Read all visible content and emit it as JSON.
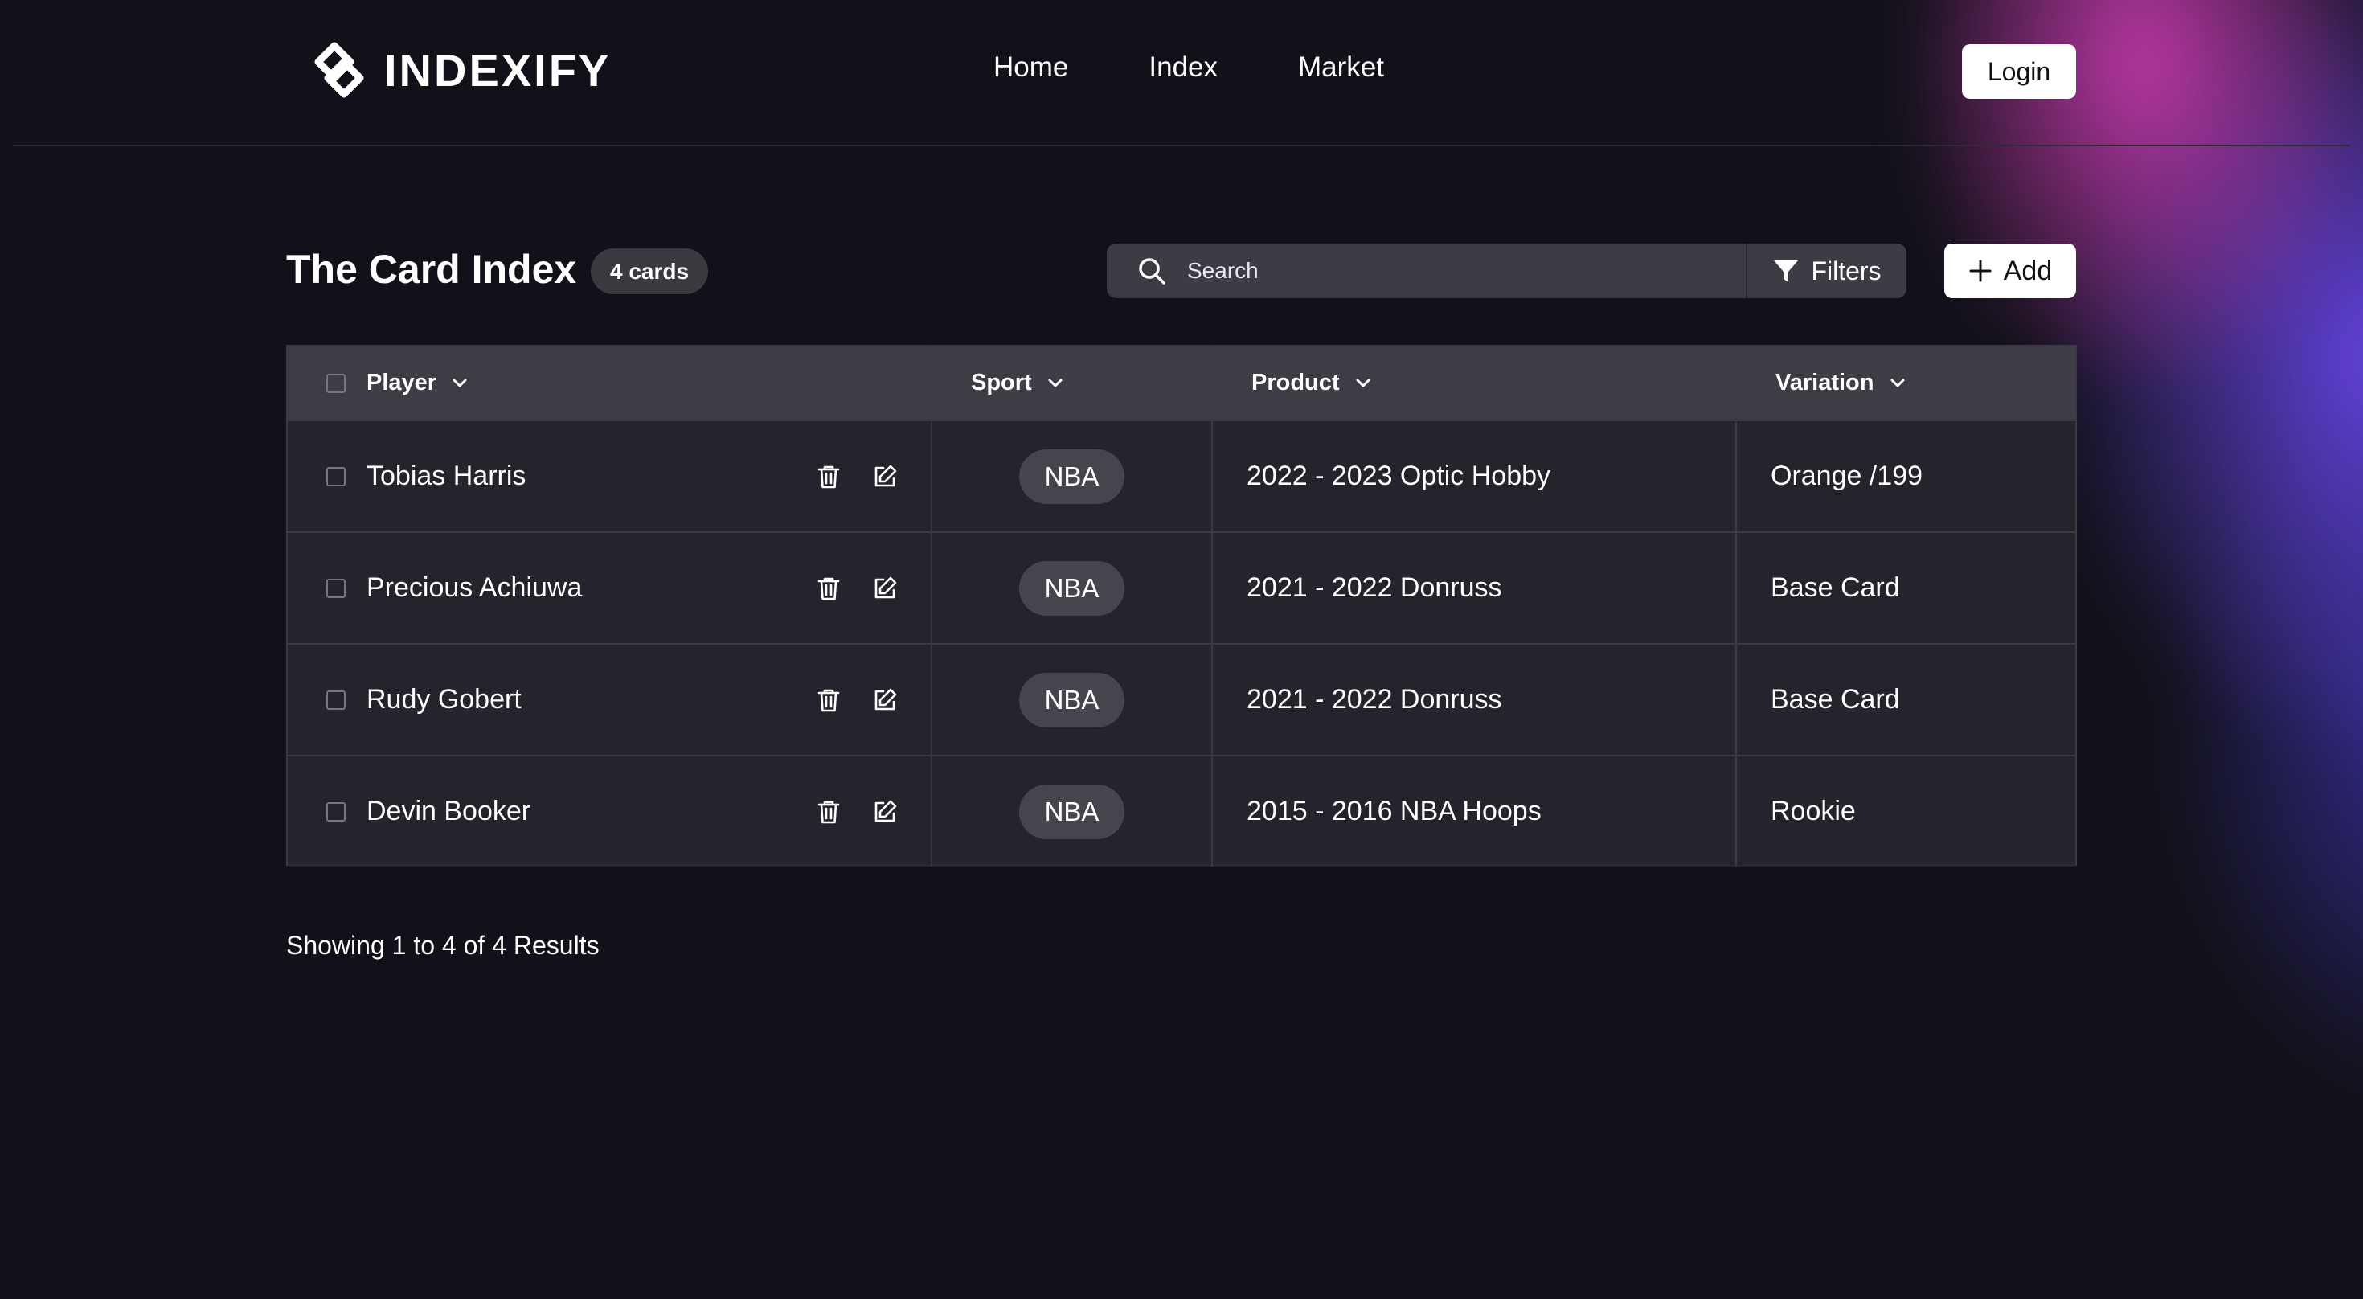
{
  "header": {
    "logo_text": "INDEXIFY",
    "nav": [
      {
        "label": "Home"
      },
      {
        "label": "Index"
      },
      {
        "label": "Market"
      }
    ],
    "login_label": "Login"
  },
  "toolbar": {
    "title": "The Card Index",
    "count_badge": "4 cards",
    "search_placeholder": "Search",
    "filters_label": "Filters",
    "add_label": "Add"
  },
  "table": {
    "columns": [
      "Player",
      "Sport",
      "Product",
      "Variation"
    ],
    "rows": [
      {
        "player": "Tobias Harris",
        "sport": "NBA",
        "product": "2022 - 2023 Optic Hobby",
        "variation": "Orange /199"
      },
      {
        "player": "Precious Achiuwa",
        "sport": "NBA",
        "product": "2021 - 2022 Donruss",
        "variation": "Base Card"
      },
      {
        "player": "Rudy Gobert",
        "sport": "NBA",
        "product": "2021 - 2022 Donruss",
        "variation": "Base Card"
      },
      {
        "player": "Devin Booker",
        "sport": "NBA",
        "product": "2015 - 2016 NBA Hoops",
        "variation": "Rookie"
      }
    ]
  },
  "footer": {
    "results_text": "Showing 1 to 4 of 4 Results"
  },
  "icons": {
    "logo": "indexify-logo-icon",
    "search": "search-icon",
    "filter": "filter-icon",
    "add": "plus-icon",
    "sort": "chevron-down-icon",
    "delete": "trash-icon",
    "edit": "edit-icon"
  },
  "colors": {
    "background": "#12111a",
    "table_header": "#42414a",
    "table_row": "#28272f",
    "badge": "#46454d",
    "glow_pink": "#cd3cb4",
    "glow_violet": "#6946eb"
  }
}
